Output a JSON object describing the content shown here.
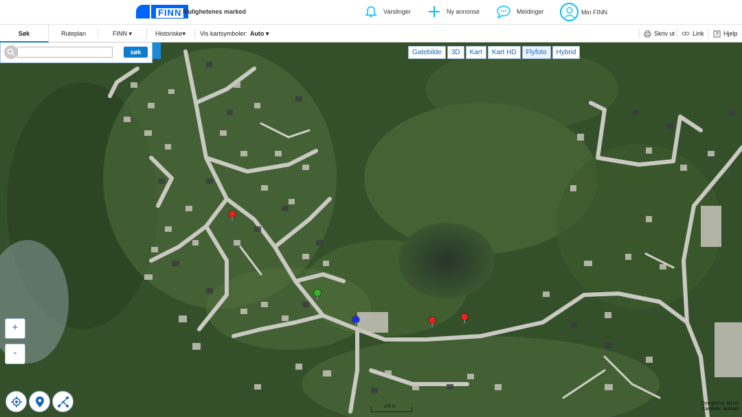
{
  "header": {
    "logo_text": "FINN",
    "tagline": "Mulighetenes marked",
    "nav": [
      {
        "label": "Varslinger",
        "icon": "bell-icon"
      },
      {
        "label": "Ny annonse",
        "icon": "plus-icon"
      },
      {
        "label": "Meldinger",
        "icon": "chat-icon"
      },
      {
        "label": "Min FINN",
        "icon": "user-icon"
      }
    ]
  },
  "toolbar": {
    "tabs": [
      "Søk",
      "Ruteplan",
      "FINN ▾",
      "Historiske▾"
    ],
    "map_symbols_label": "Vis kartsymboler:",
    "map_symbols_value": "Auto ▾",
    "print_label": "Skriv ut",
    "link_label": "Link",
    "help_label": "Hjelp"
  },
  "search": {
    "value": "",
    "button_label": "søk"
  },
  "map_types": [
    "Gatebilde",
    "3D",
    "Kart",
    "Kart HD",
    "Flyfoto",
    "Hybrid"
  ],
  "active_map_type": "Flyfoto",
  "zoom": {
    "in_label": "+",
    "out_label": "-"
  },
  "pins": [
    {
      "color": "#e0231f"
    },
    {
      "color": "#2db52a"
    },
    {
      "color": "#1b2df0"
    },
    {
      "color": "#e0231f"
    },
    {
      "color": "#e0231f"
    }
  ],
  "scale_label": "100 m",
  "copyright": [
    "Dyregrend, Bil.no",
    "Kartdata: Norkart"
  ],
  "colors": {
    "brand": "#0063fb",
    "accent": "#0f7dcf"
  }
}
